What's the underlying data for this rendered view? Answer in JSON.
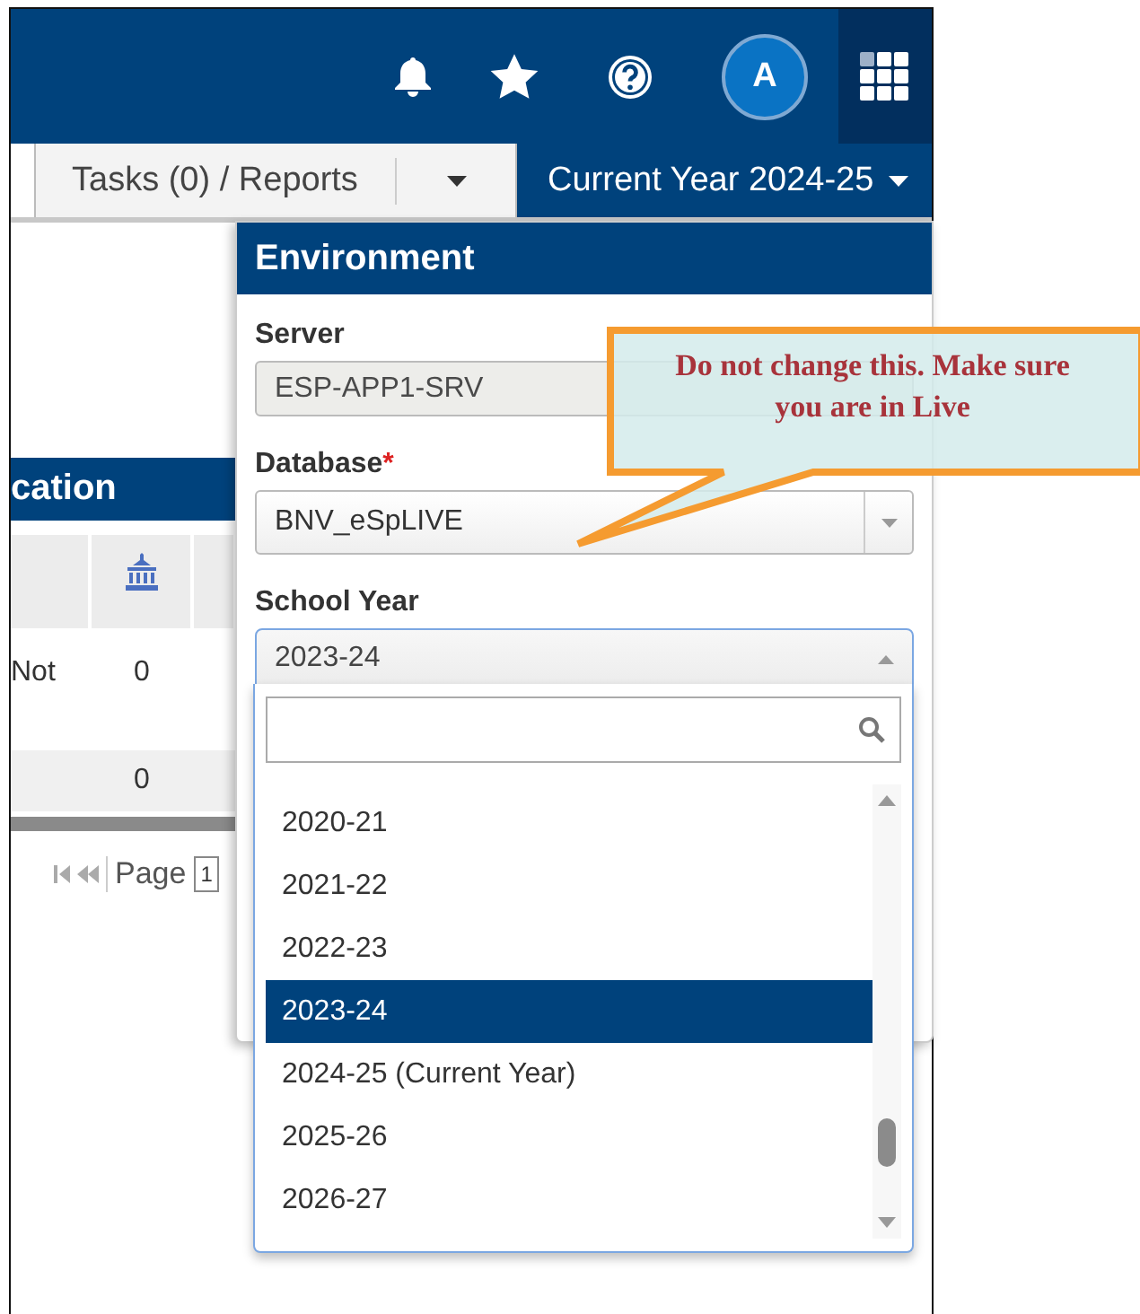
{
  "topbar": {
    "avatar": "A"
  },
  "subbar": {
    "tasks_tab": "Tasks (0) / Reports",
    "year_menu": "Current Year 2024-25"
  },
  "background_panel": {
    "title": "cation",
    "rows": [
      {
        "label": "Not",
        "value": "0"
      },
      {
        "value": "0"
      }
    ],
    "pager": {
      "label": "Page",
      "page": "1"
    }
  },
  "environment": {
    "title": "Environment",
    "server": {
      "label": "Server",
      "value": "ESP-APP1-SRV",
      "disabled": true
    },
    "database": {
      "label": "Database",
      "required_mark": "*",
      "value": "BNV_eSpLIVE"
    },
    "school_year": {
      "label": "School Year",
      "value": "2023-24",
      "expanded": true,
      "options": [
        {
          "label": "2020-21",
          "selected": false
        },
        {
          "label": "2021-22",
          "selected": false
        },
        {
          "label": "2022-23",
          "selected": false
        },
        {
          "label": "2023-24",
          "selected": true
        },
        {
          "label": "2024-25 (Current Year)",
          "selected": false
        },
        {
          "label": "2025-26",
          "selected": false
        },
        {
          "label": "2026-27",
          "selected": false
        }
      ]
    }
  },
  "callout": {
    "text": "Do not change this. Make sure you are in Live"
  }
}
